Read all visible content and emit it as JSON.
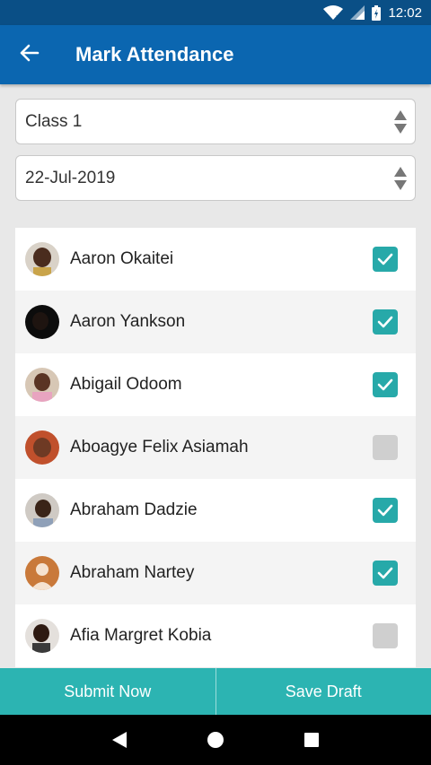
{
  "status_bar": {
    "time": "12:02",
    "icons": [
      "wifi-icon",
      "signal-icon",
      "battery-icon"
    ]
  },
  "app_bar": {
    "title": "Mark Attendance",
    "back_icon": "arrow-left-icon"
  },
  "filters": {
    "class_value": "Class 1",
    "date_value": "22-Jul-2019"
  },
  "students": [
    {
      "name": "Aaron Okaitei",
      "present": true
    },
    {
      "name": "Aaron Yankson",
      "present": true
    },
    {
      "name": "Abigail Odoom",
      "present": true
    },
    {
      "name": "Aboagye Felix Asiamah",
      "present": false
    },
    {
      "name": "Abraham Dadzie",
      "present": true
    },
    {
      "name": "Abraham Nartey",
      "present": true
    },
    {
      "name": "Afia Margret Kobia",
      "present": false
    }
  ],
  "actions": {
    "submit_label": "Submit Now",
    "draft_label": "Save Draft"
  },
  "nav": {
    "icons": [
      "back-triangle-icon",
      "home-circle-icon",
      "recents-square-icon"
    ]
  },
  "colors": {
    "status_bar": "#0a4f86",
    "app_bar": "#0b66b0",
    "accent": "#27a9a9",
    "bottom_bar": "#2cb4b2"
  }
}
